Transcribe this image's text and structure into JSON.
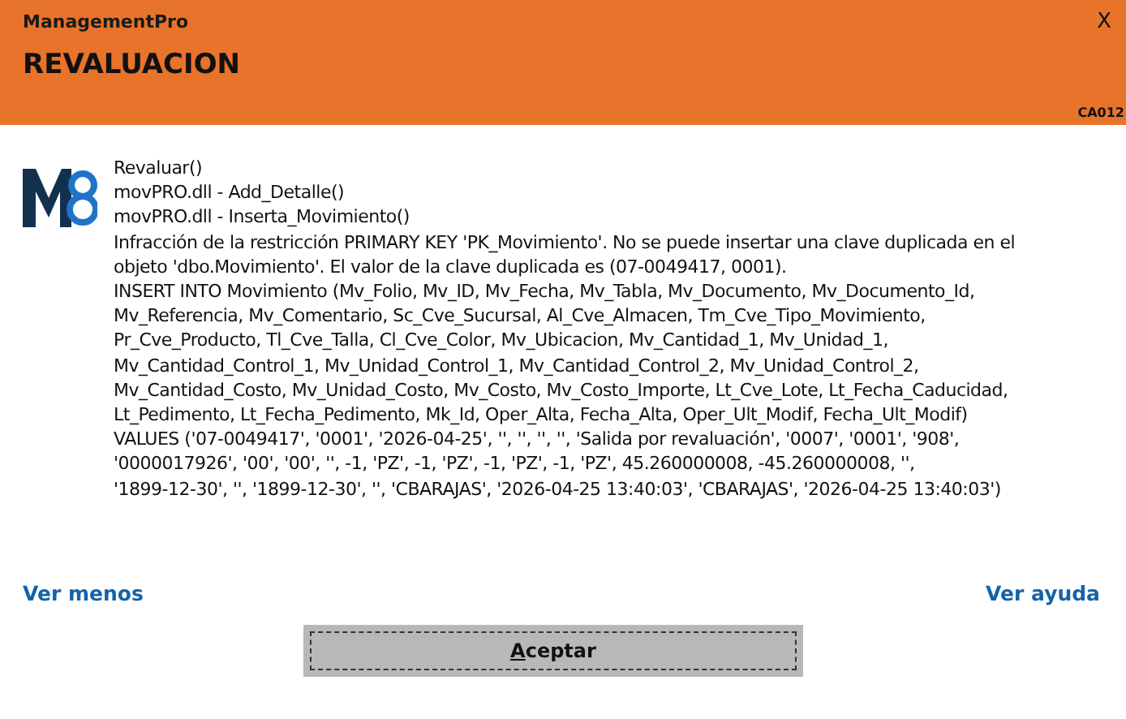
{
  "window": {
    "app_name": "ManagementPro",
    "close": "X",
    "title": "REVALUACION",
    "code": "CA012"
  },
  "message": {
    "lines": [
      "Revaluar()",
      "movPRO.dll - Add_Detalle()",
      "movPRO.dll - Inserta_Movimiento()",
      "Infracción de la restricción PRIMARY KEY 'PK_Movimiento'. No se puede insertar una clave duplicada en el",
      "objeto 'dbo.Movimiento'. El valor de la clave duplicada es (07-0049417, 0001).",
      "INSERT INTO Movimiento (Mv_Folio, Mv_ID, Mv_Fecha, Mv_Tabla, Mv_Documento, Mv_Documento_Id,",
      "Mv_Referencia, Mv_Comentario, Sc_Cve_Sucursal, Al_Cve_Almacen, Tm_Cve_Tipo_Movimiento,",
      "Pr_Cve_Producto, Tl_Cve_Talla, Cl_Cve_Color, Mv_Ubicacion, Mv_Cantidad_1, Mv_Unidad_1,",
      "Mv_Cantidad_Control_1, Mv_Unidad_Control_1, Mv_Cantidad_Control_2, Mv_Unidad_Control_2,",
      "Mv_Cantidad_Costo, Mv_Unidad_Costo, Mv_Costo, Mv_Costo_Importe, Lt_Cve_Lote, Lt_Fecha_Caducidad,",
      "Lt_Pedimento, Lt_Fecha_Pedimento, Mk_Id, Oper_Alta, Fecha_Alta, Oper_Ult_Modif, Fecha_Ult_Modif)",
      "VALUES ('07-0049417', '0001', '2026-04-25', '', '', '', '', 'Salida por revaluación', '0007', '0001', '908',",
      "'0000017926', '00', '00', '', -1, 'PZ', -1, 'PZ', -1, 'PZ', -1, 'PZ', 45.260000008, -45.260000008, '',",
      "'1899-12-30', '', '1899-12-30', '', 'CBARAJAS', '2026-04-25 13:40:03', 'CBARAJAS', '2026-04-25 13:40:03')"
    ]
  },
  "links": {
    "less": "Ver menos",
    "help": "Ver ayuda"
  },
  "buttons": [
    {
      "label": "Aceptar",
      "focused": true
    }
  ]
}
